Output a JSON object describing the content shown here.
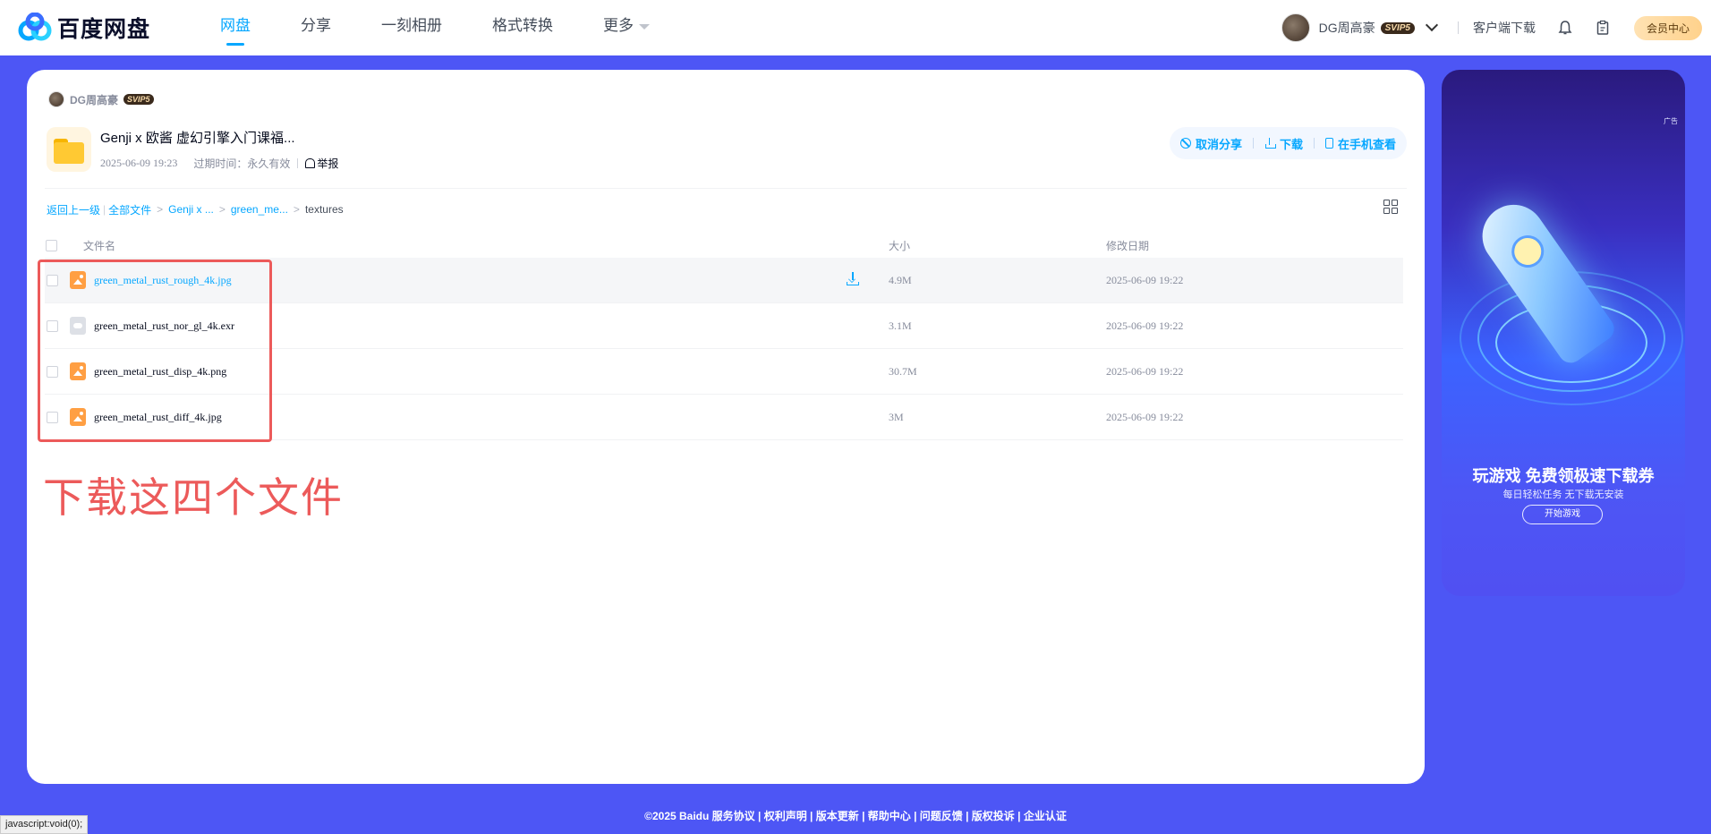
{
  "app": {
    "logo_text": "百度网盘"
  },
  "nav": {
    "items": [
      {
        "label": "网盘",
        "active": true
      },
      {
        "label": "分享"
      },
      {
        "label": "一刻相册"
      },
      {
        "label": "格式转换"
      },
      {
        "label": "更多"
      }
    ]
  },
  "user": {
    "name": "DG周高豪",
    "vip": "SVIP5"
  },
  "top_right": {
    "client_download": "客户端下载",
    "vip_center": "会员中心"
  },
  "share": {
    "sharer": "DG周高豪",
    "sharer_vip": "SVIP5",
    "folder_title": "Genji x 欧酱 虚幻引擎入门课福...",
    "date": "2025-06-09 19:23",
    "expiry": "过期时间：永久有效",
    "report": "举报"
  },
  "actions": {
    "cancel_share": "取消分享",
    "download": "下载",
    "view_on_phone": "在手机查看"
  },
  "breadcrumb": {
    "back": "返回上一级",
    "all_files": "全部文件",
    "level1": "Genji x ...",
    "level2": "green_me...",
    "current": "textures"
  },
  "table": {
    "headers": {
      "name": "文件名",
      "size": "大小",
      "date": "修改日期"
    },
    "rows": [
      {
        "name": "green_metal_rust_rough_4k.jpg",
        "size": "4.9M",
        "date": "2025-06-09 19:22",
        "type": "image"
      },
      {
        "name": "green_metal_rust_nor_gl_4k.exr",
        "size": "3.1M",
        "date": "2025-06-09 19:22",
        "type": "generic"
      },
      {
        "name": "green_metal_rust_disp_4k.png",
        "size": "30.7M",
        "date": "2025-06-09 19:22",
        "type": "image"
      },
      {
        "name": "green_metal_rust_diff_4k.jpg",
        "size": "3M",
        "date": "2025-06-09 19:22",
        "type": "image"
      }
    ]
  },
  "annotation": {
    "text": "下载这四个文件",
    "color": "#ec5a5a"
  },
  "ad": {
    "label": "广告",
    "title": "玩游戏 免费领极速下载券",
    "subtitle": "每日轻松任务 无下载无安装",
    "button": "开始游戏"
  },
  "footer": {
    "text": "©2025 Baidu  服务协议 | 权利声明 | 版本更新 | 帮助中心 | 问题反馈 | 版权投诉 | 企业认证"
  },
  "status_bar": {
    "text": "javascript:void(0);"
  },
  "colors": {
    "accent": "#06a7ff",
    "background": "#4d56f5"
  }
}
